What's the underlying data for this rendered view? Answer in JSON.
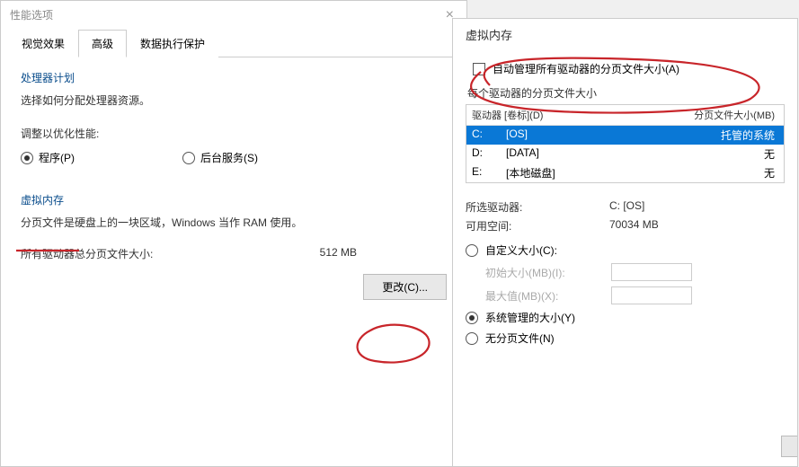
{
  "leftWindow": {
    "title": "性能选项",
    "tabs": [
      "视觉效果",
      "高级",
      "数据执行保护"
    ],
    "activeTab": 1,
    "processor": {
      "groupTitle": "处理器计划",
      "desc": "选择如何分配处理器资源。",
      "adjustLabel": "调整以优化性能:",
      "optProgram": "程序(P)",
      "optBackground": "后台服务(S)"
    },
    "virtualMemory": {
      "groupTitle": "虚拟内存",
      "desc": "分页文件是硬盘上的一块区域，Windows 当作 RAM 使用。",
      "totalLabel": "所有驱动器总分页文件大小:",
      "totalValue": "512 MB",
      "changeBtn": "更改(C)..."
    }
  },
  "rightWindow": {
    "title": "虚拟内存",
    "autoManage": "自动管理所有驱动器的分页文件大小(A)",
    "perDriveLabel": "每个驱动器的分页文件大小",
    "headers": {
      "drive": "驱动器 [卷标](D)",
      "page": "分页文件大小(MB)"
    },
    "drives": [
      {
        "letter": "C:",
        "label": "[OS]",
        "page": "托管的系统",
        "selected": true
      },
      {
        "letter": "D:",
        "label": "[DATA]",
        "page": "无",
        "selected": false
      },
      {
        "letter": "E:",
        "label": "[本地磁盘]",
        "page": "无",
        "selected": false
      }
    ],
    "selectedDriveLabel": "所选驱动器:",
    "selectedDriveValue": "C:  [OS]",
    "freeSpaceLabel": "可用空间:",
    "freeSpaceValue": "70034 MB",
    "customSize": "自定义大小(C):",
    "initialSizeLabel": "初始大小(MB)(I):",
    "maxSizeLabel": "最大值(MB)(X):",
    "systemManaged": "系统管理的大小(Y)",
    "noPageFile": "无分页文件(N)"
  }
}
